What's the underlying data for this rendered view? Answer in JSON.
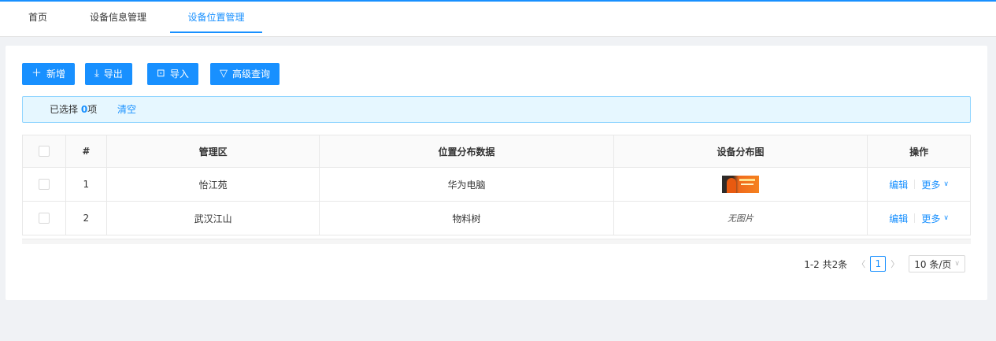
{
  "tabs": [
    {
      "label": "首页"
    },
    {
      "label": "设备信息管理"
    },
    {
      "label": "设备位置管理"
    }
  ],
  "toolbar": {
    "add_label": "新增",
    "export_label": "导出",
    "import_label": "导入",
    "query_label": "高级查询"
  },
  "selection": {
    "prefix": "已选择 ",
    "count": "0",
    "suffix": "项",
    "clear_label": "清空"
  },
  "table": {
    "columns": [
      "#",
      "管理区",
      "位置分布数据",
      "设备分布图",
      "操作"
    ],
    "rows": [
      {
        "index": "1",
        "area": "怡江苑",
        "data": "华为电脑",
        "image": "thumbnail"
      },
      {
        "index": "2",
        "area": "武汉江山",
        "data": "物料树",
        "image": "无图片"
      }
    ],
    "edit_label": "编辑",
    "more_label": "更多"
  },
  "pagination": {
    "summary": "1-2 共2条",
    "current": "1",
    "page_size": "10 条/页"
  },
  "colors": {
    "primary": "#1890ff",
    "alert_bg": "#e6f7ff",
    "page_bg": "#f0f2f5"
  }
}
